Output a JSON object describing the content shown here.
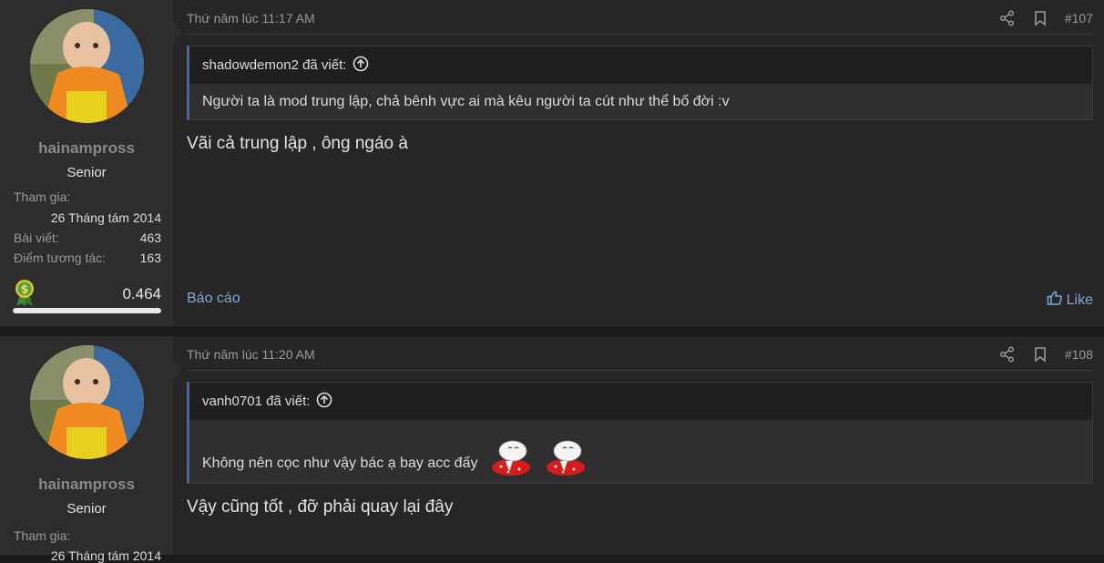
{
  "posts": [
    {
      "user": {
        "name": "hainampross",
        "rank": "Senior",
        "join_label": "Tham gia:",
        "join_value": "26 Tháng tám 2014",
        "posts_label": "Bài viết:",
        "posts_value": "463",
        "reactions_label": "Điểm tương tác:",
        "reactions_value": "163",
        "money_value": "0.464",
        "money_progress": 1.0
      },
      "date": "Thứ năm lúc 11:17 AM",
      "number": "#107",
      "quote": {
        "author": "shadowdemon2 đã viết:",
        "text": "Người ta là mod trung lập, chả bênh vực ai mà kêu người ta cút như thể bố đời :v"
      },
      "message": "Vãi cả trung lập , ông ngáo à",
      "report": "Báo cáo",
      "like": "Like"
    },
    {
      "user": {
        "name": "hainampross",
        "rank": "Senior",
        "join_label": "Tham gia:",
        "join_value": "26 Tháng tám 2014"
      },
      "date": "Thứ năm lúc 11:20 AM",
      "number": "#108",
      "quote": {
        "author": "vanh0701 đã viết:",
        "text": "Không nên cọc như vậy bác ạ bay acc đấy"
      },
      "message": "Vậy cũng tốt , đỡ phải quay lại đây"
    }
  ],
  "colors": {
    "link": "#7fa8d9",
    "quote_border": "#3a6aa8",
    "background": "#262626",
    "sidebar": "#2d2d2d"
  },
  "icons": [
    "share-icon",
    "bookmark-icon",
    "arrow-up-circle-icon",
    "thumbs-up-icon",
    "money-medal-icon",
    "emoji-sticker"
  ]
}
